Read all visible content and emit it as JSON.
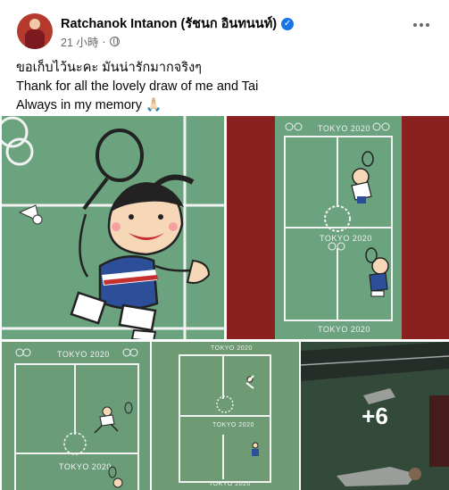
{
  "post": {
    "author": "Ratchanok Intanon (รัชนก อินทนนท์)",
    "verified_icon": "verified-check-icon",
    "time": "21 小時",
    "separator": "·",
    "privacy_icon": "globe-icon",
    "menu_icon": "more-horizontal-icon",
    "caption_lines": [
      "ขอเก็บไว้นะคะ มันน่ารักมากจริงๆ",
      "Thank for all the lovely draw of me and Tai",
      "Always in my memory 🙏🏻"
    ]
  },
  "photos": {
    "labels": {
      "tile2_top": "TOKYO 2020",
      "tile2_mid": "TOKYO 2020",
      "tile2_bottom": "TOKYO 2020",
      "tile3_top": "TOKYO 2020",
      "tile3_mid": "TOKYO 2020",
      "tile4_top": "TOKYO 2020",
      "tile4_mid": "TOKYO 2020",
      "tile4_bottom": "TOKYO 2020"
    },
    "more_count": "+6"
  },
  "colors": {
    "court_green": "#6aa37d",
    "court_red": "#8b2020",
    "verified_blue": "#1b74e4",
    "meta_gray": "#65676b"
  }
}
